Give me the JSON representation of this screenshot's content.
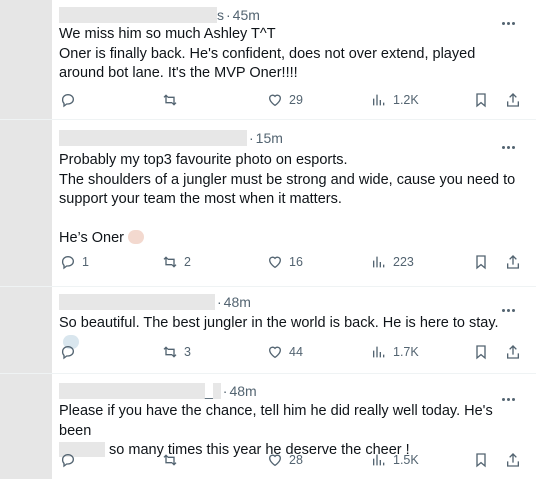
{
  "tweets": [
    {
      "time": "45m",
      "name_tail": "s",
      "lines": [
        "We miss him so much Ashley T^T",
        "Oner is finally back. He's confident, does not over extend, played around bot lane. It's the MVP Oner!!!!"
      ],
      "replies": "",
      "retweets": "",
      "likes": "29",
      "views": "1.2K"
    },
    {
      "time": "15m",
      "lines": [
        "Probably my top3 favourite photo on esports.",
        "The shoulders of a jungler must be strong and wide, cause you need to support your team the most when it matters."
      ],
      "line3": "He’s Oner",
      "replies": "1",
      "retweets": "2",
      "likes": "16",
      "views": "223"
    },
    {
      "time": "48m",
      "lines": [
        "So beautiful. The best jungler in the world is back. He is here to stay."
      ],
      "replies": "",
      "retweets": "3",
      "likes": "44",
      "views": "1.7K"
    },
    {
      "time": "48m",
      "name_tail": "_",
      "line1": "Please if you have the chance, tell him he did really well today. He's been",
      "line2": "so many times this year he deserve the cheer !",
      "replies": "",
      "retweets": "",
      "likes": "28",
      "views": "1.5K"
    }
  ],
  "icons": {
    "reply": "reply-icon",
    "retweet": "retweet-icon",
    "like": "heart-icon",
    "views": "views-icon",
    "bookmark": "bookmark-icon",
    "share": "share-icon",
    "more": "more-icon"
  },
  "colors": {
    "text": "#0f1419",
    "muted": "#536471",
    "divider": "#eff3f4"
  }
}
